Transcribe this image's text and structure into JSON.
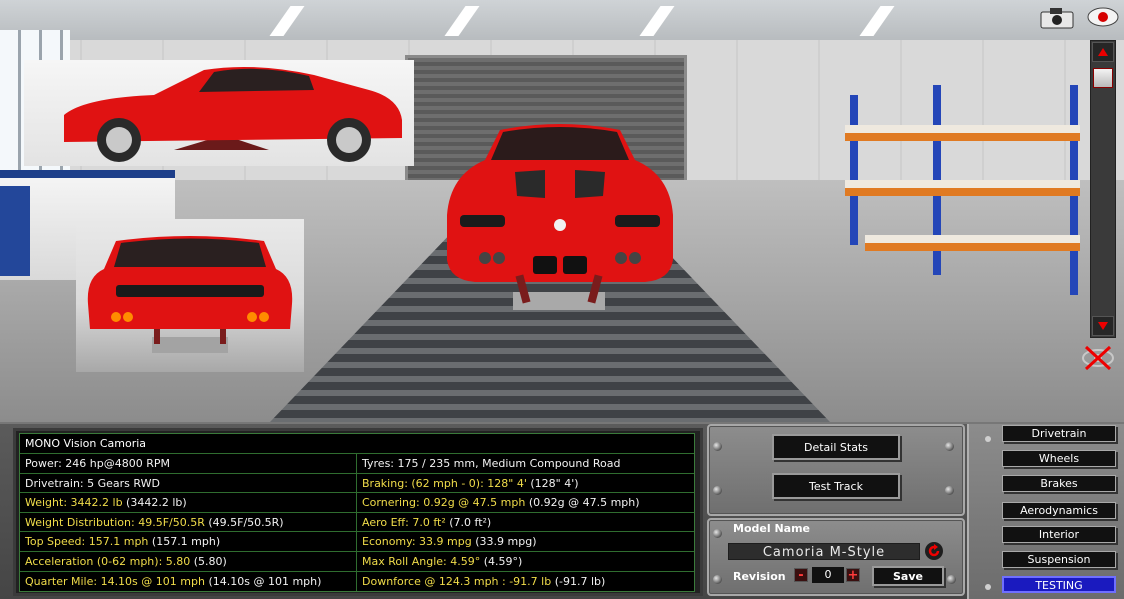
{
  "scene": {
    "camera_icon": "camera-icon",
    "eye_icon": "eye-icon",
    "reset_view_icon": "reset-view-icon"
  },
  "stats": {
    "title": "MONO Vision Camoria",
    "rows": [
      {
        "left": {
          "text": "Power: 246 hp@4800 RPM",
          "paren": "",
          "color": "white"
        },
        "right": {
          "text": "Tyres: 175 / 235 mm, Medium Compound Road",
          "paren": "",
          "color": "white"
        }
      },
      {
        "left": {
          "text": "Drivetrain: 5 Gears RWD",
          "paren": "",
          "color": "white"
        },
        "right": {
          "text": "Braking: (62 mph - 0): 128\" 4'",
          "paren": " (128\" 4')",
          "color": "yellow"
        }
      },
      {
        "left": {
          "text": "Weight: 3442.2 lb",
          "paren": " (3442.2 lb)",
          "color": "yellow"
        },
        "right": {
          "text": "Cornering: 0.92g @ 47.5 mph",
          "paren": " (0.92g @ 47.5 mph)",
          "color": "yellow"
        }
      },
      {
        "left": {
          "text": "Weight Distribution: 49.5F/50.5R",
          "paren": " (49.5F/50.5R)",
          "color": "yellow"
        },
        "right": {
          "text": "Aero Eff: 7.0 ft²",
          "paren": " (7.0 ft²)",
          "color": "yellow"
        }
      },
      {
        "left": {
          "text": "Top Speed: 157.1 mph",
          "paren": " (157.1 mph)",
          "color": "yellow"
        },
        "right": {
          "text": "Economy: 33.9 mpg",
          "paren": " (33.9 mpg)",
          "color": "yellow"
        }
      },
      {
        "left": {
          "text": "Acceleration (0-62 mph): 5.80",
          "paren": " (5.80)",
          "color": "yellow"
        },
        "right": {
          "text": "Max Roll Angle: 4.59°",
          "paren": " (4.59°)",
          "color": "yellow"
        }
      },
      {
        "left": {
          "text": "Quarter Mile: 14.10s @ 101 mph",
          "paren": " (14.10s @ 101 mph)",
          "color": "yellow"
        },
        "right": {
          "text": "Downforce @ 124.3 mph : -91.7 lb",
          "paren": " (-91.7 lb)",
          "color": "yellow"
        }
      }
    ]
  },
  "actions": {
    "detail_stats": "Detail Stats",
    "test_track": "Test Track"
  },
  "model": {
    "name_label": "Model Name",
    "name_value": "Camoria M-Style",
    "revision_label": "Revision",
    "revision_minus": "-",
    "revision_value": "0",
    "revision_plus": "+",
    "save": "Save"
  },
  "tabs": [
    {
      "label": "Drivetrain",
      "active": false
    },
    {
      "label": "Wheels",
      "active": false
    },
    {
      "label": "Brakes",
      "active": false
    },
    {
      "label": "Aerodynamics",
      "active": false
    },
    {
      "label": "Interior",
      "active": false
    },
    {
      "label": "Suspension",
      "active": false
    },
    {
      "label": "TESTING",
      "active": true
    }
  ],
  "colors": {
    "car_red": "#e01212",
    "stat_yellow": "#f0dc4a",
    "stat_green_border": "#2f6d2f",
    "active_tab": "#1a1abf"
  }
}
